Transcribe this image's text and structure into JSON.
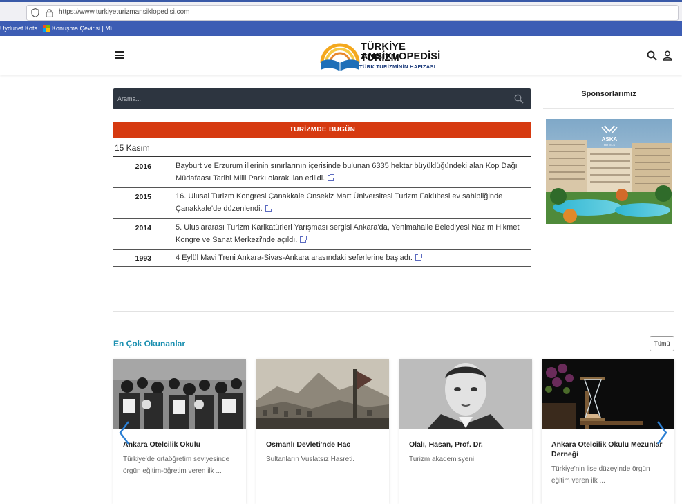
{
  "browser": {
    "url": "https://www.turkiyeturizmansiklopedisi.com",
    "bookmarks": [
      "Uydunet Kota",
      "Konuşma Çevirisi | Mi..."
    ]
  },
  "header": {
    "logo_line1": "TÜRKİYE TURİZM",
    "logo_line2": "ANSİKLOPEDİSİ",
    "logo_tagline": "TÜRK TURİZMİNİN HAFIZASI",
    "icons": [
      "menu-icon",
      "search-icon",
      "user-icon"
    ]
  },
  "search": {
    "placeholder": "Arama..."
  },
  "today": {
    "title": "TURİZMDE BUGÜN",
    "date": "15 Kasım",
    "events": [
      {
        "year": "2016",
        "text": "Bayburt ve Erzurum illerinin sınırlarının içerisinde bulunan 6335 hektar büyüklüğündeki alan Kop Dağı Müdafaası Tarihi Milli Parkı olarak ilan edildi."
      },
      {
        "year": "2015",
        "text": "16. Ulusal Turizm Kongresi Çanakkale Onsekiz Mart Üniversitesi Turizm Fakültesi ev sahipliğinde Çanakkale'de düzenlendi."
      },
      {
        "year": "2014",
        "text": "5. Uluslararası Turizm Karikatürleri Yarışması sergisi Ankara'da, Yenimahalle Belediyesi Nazım Hikmet Kongre ve Sanat Merkezi'nde açıldı."
      },
      {
        "year": "1993",
        "text": "4 Eylül Mavi Treni Ankara-Sivas-Ankara arasındaki seferlerine başladı."
      }
    ]
  },
  "sponsors": {
    "title": "Sponsorlarımız",
    "brand": "ASKA",
    "brand_sub": "HOTELS"
  },
  "most_read": {
    "title": "En Çok Okunanlar",
    "all_label": "Tümü",
    "cards": [
      {
        "title": "Ankara Otelcilik Okulu",
        "desc": "Türkiye'de ortaöğretim seviyesinde örgün eğitim-öğretim veren ilk ..."
      },
      {
        "title": "Osmanlı Devleti'nde Hac",
        "desc": "Sultanların Vuslatsız Hasreti."
      },
      {
        "title": "Olalı, Hasan, Prof. Dr.",
        "desc": "Turizm akademisyeni."
      },
      {
        "title": "Ankara Otelcilik Okulu Mezunlar Derneği",
        "desc": "Türkiye'nin lise düzeyinde örgün eğitim veren ilk ..."
      }
    ]
  },
  "colors": {
    "accent_red": "#d63a10",
    "accent_blue": "#1a8fb0",
    "search_bg": "#2d3540",
    "bookmark_bar": "#3d5db4"
  }
}
